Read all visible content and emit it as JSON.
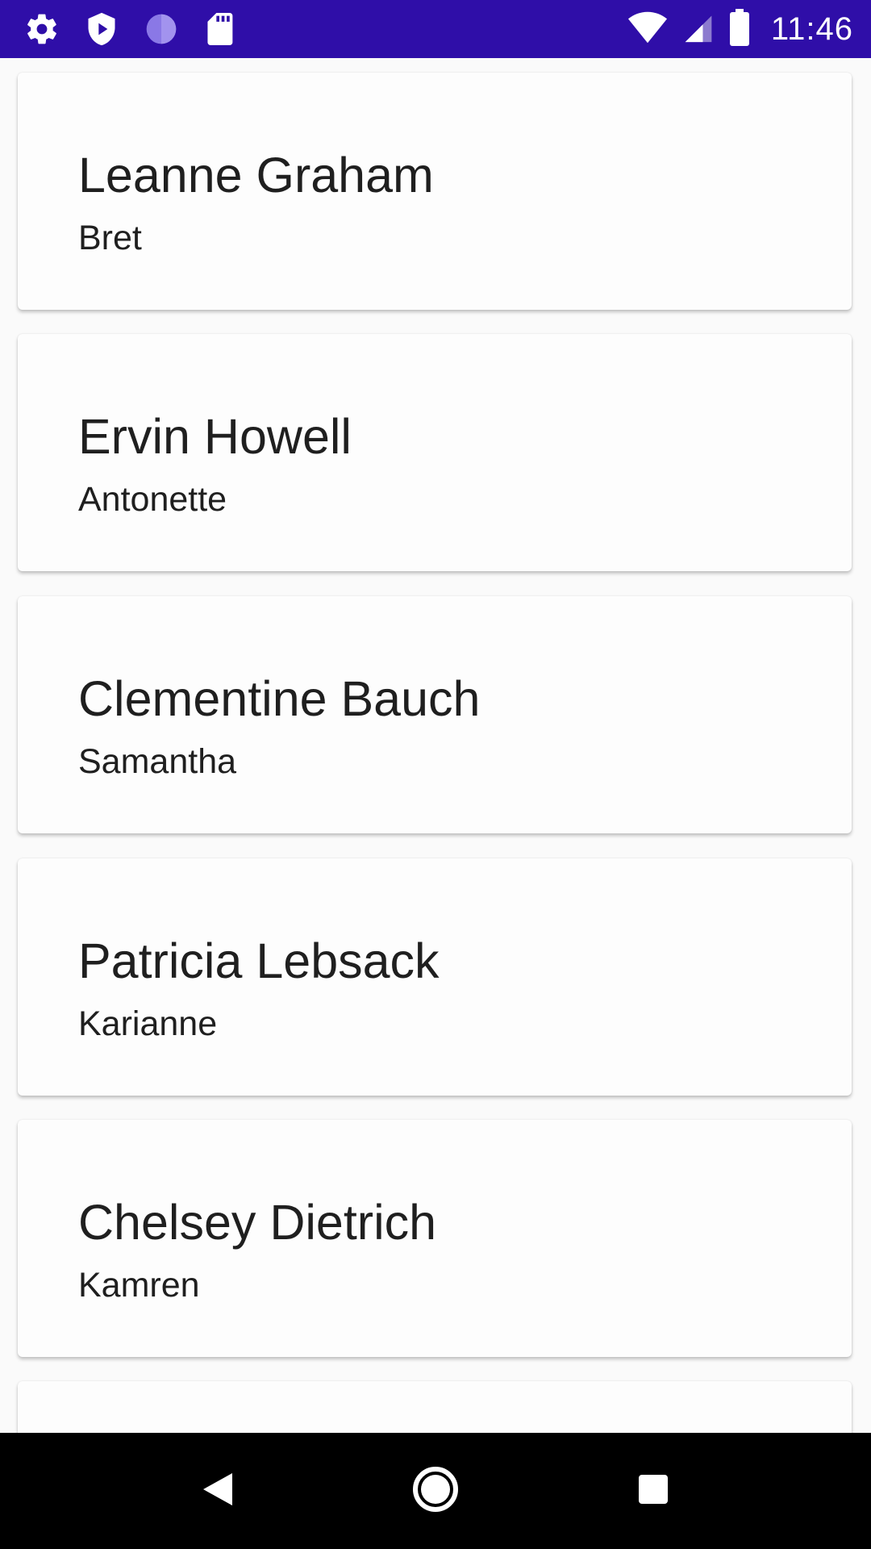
{
  "status_bar": {
    "time": "11:46",
    "left_icons": [
      "settings-icon",
      "shield-play-icon",
      "circle-icon",
      "sd-card-icon"
    ],
    "right_icons": [
      "wifi-icon",
      "cell-signal-icon",
      "battery-icon"
    ],
    "background_color": "#2f0ea8"
  },
  "users": [
    {
      "name": "Leanne Graham",
      "username": "Bret"
    },
    {
      "name": "Ervin Howell",
      "username": "Antonette"
    },
    {
      "name": "Clementine Bauch",
      "username": "Samantha"
    },
    {
      "name": "Patricia Lebsack",
      "username": "Karianne"
    },
    {
      "name": "Chelsey Dietrich",
      "username": "Kamren"
    }
  ],
  "nav_bar": {
    "buttons": [
      "back-icon",
      "home-icon",
      "recents-icon"
    ]
  }
}
